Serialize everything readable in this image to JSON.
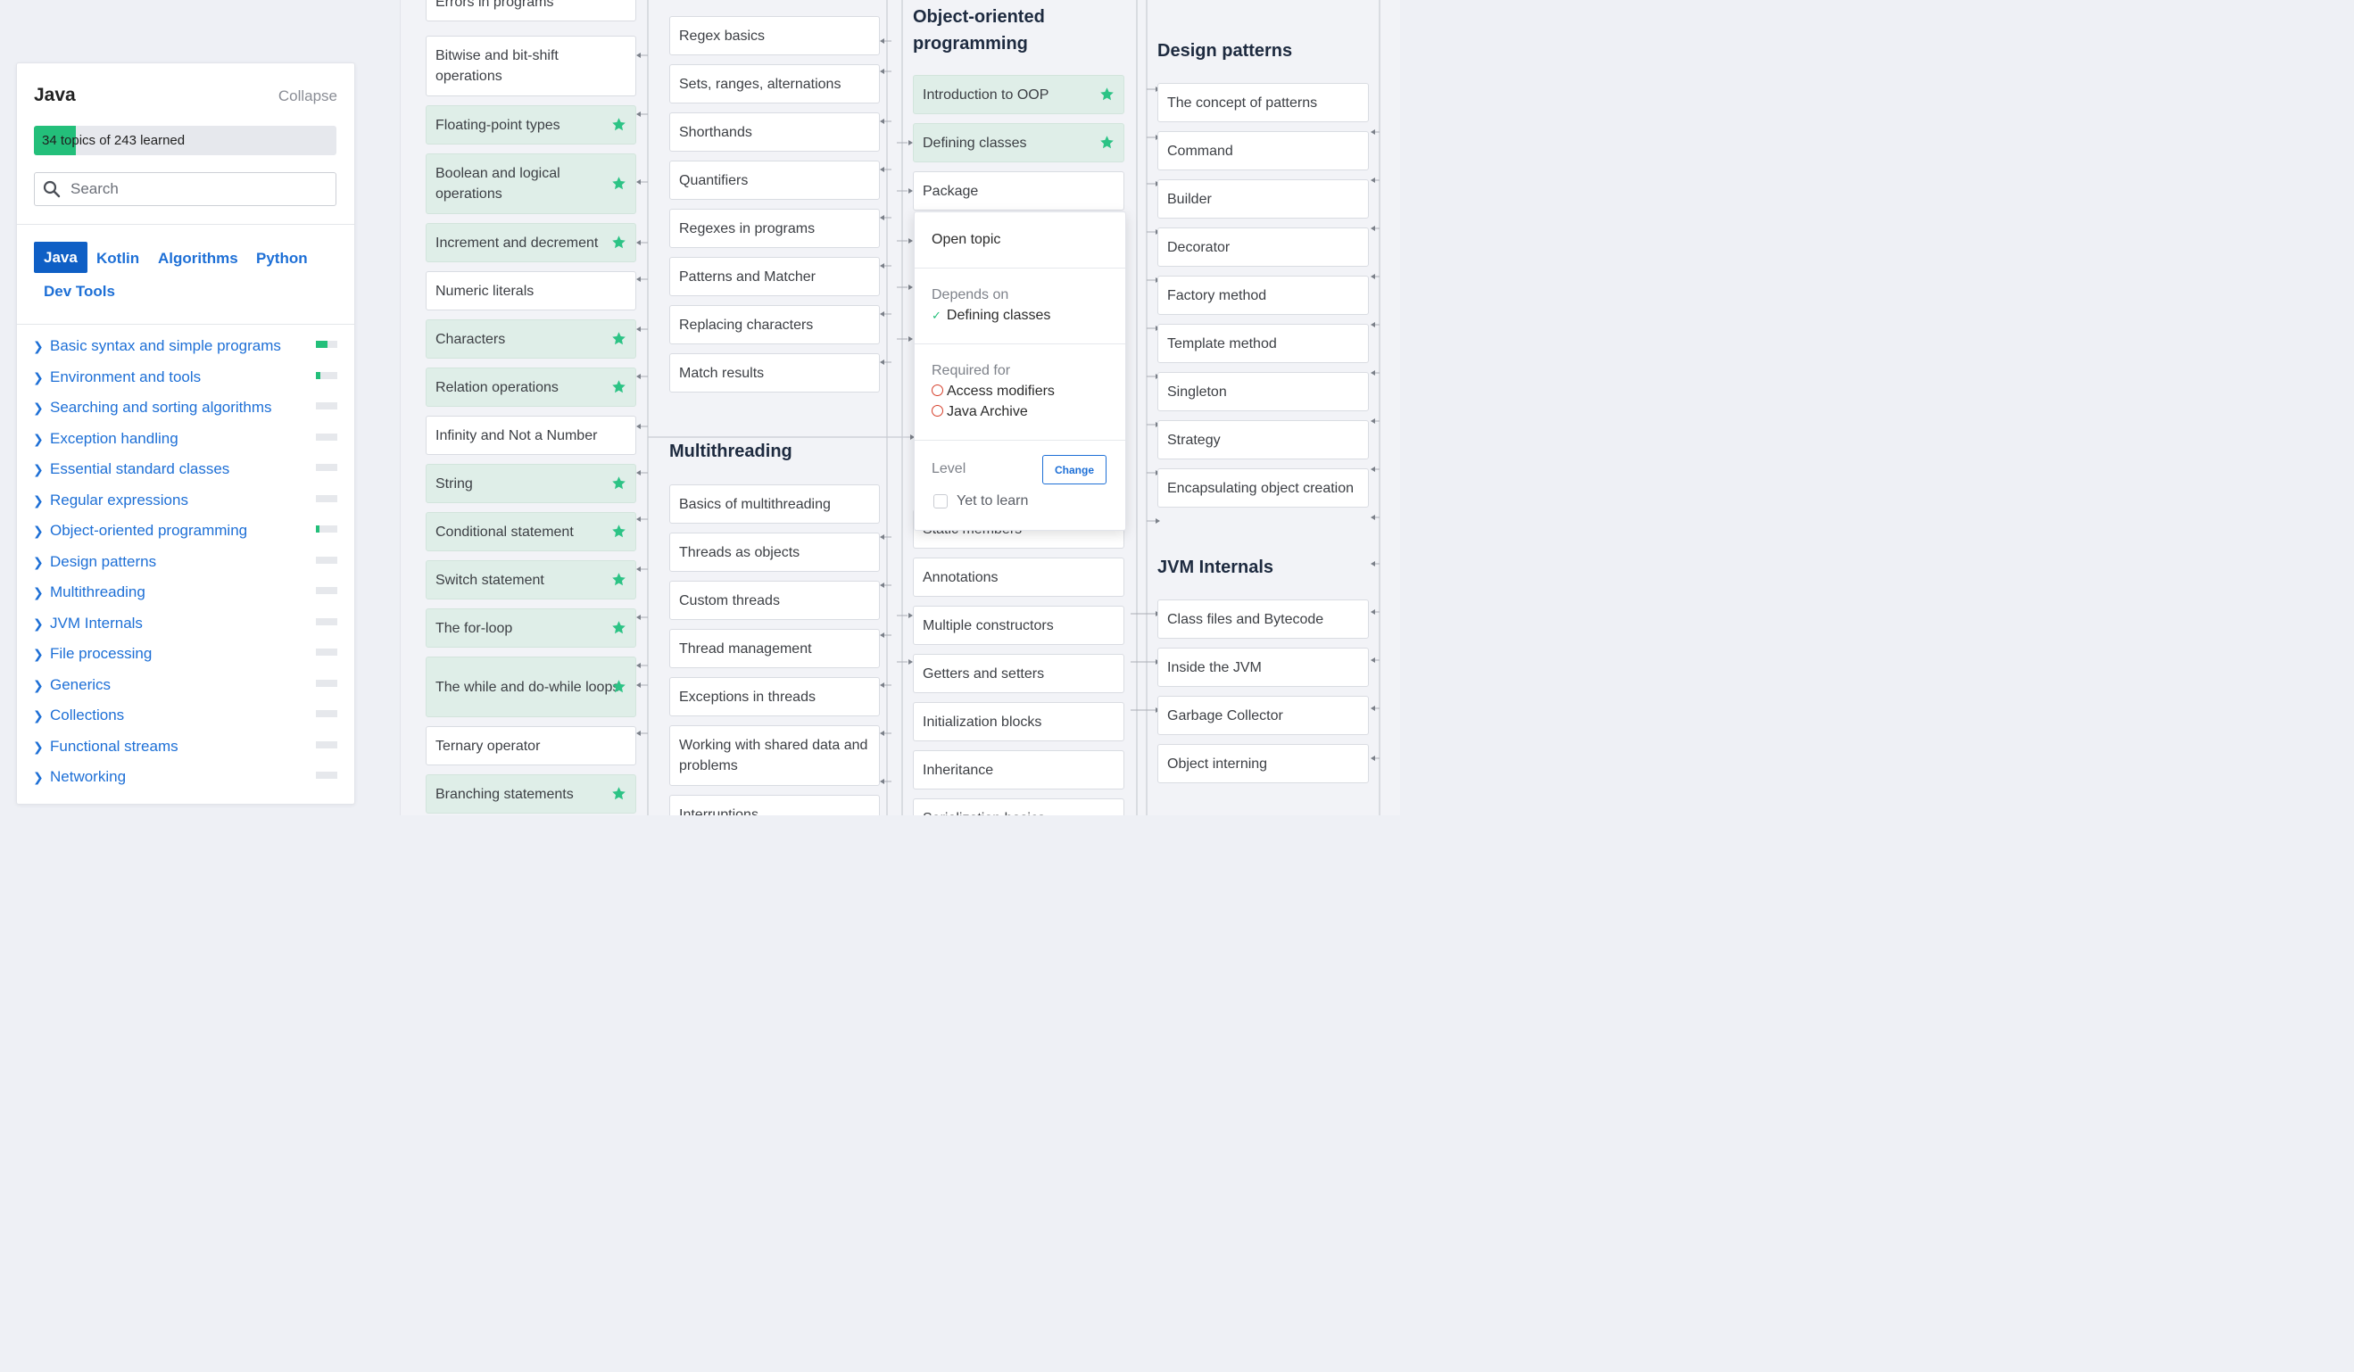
{
  "panel": {
    "title": "Java",
    "collapse": "Collapse",
    "progress_text": "34 topics of 243 learned",
    "progress_fraction": 0.14,
    "search_placeholder": "Search",
    "tabs": [
      "Java",
      "Kotlin",
      "Algorithms",
      "Python",
      "Dev Tools"
    ],
    "active_tab": "Java",
    "topics": [
      {
        "label": "Basic syntax and simple programs",
        "progress": 0.55
      },
      {
        "label": "Environment and tools",
        "progress": 0.2
      },
      {
        "label": "Searching and sorting algorithms",
        "progress": 0
      },
      {
        "label": "Exception handling",
        "progress": 0
      },
      {
        "label": "Essential standard classes",
        "progress": 0
      },
      {
        "label": "Regular expressions",
        "progress": 0
      },
      {
        "label": "Object-oriented programming",
        "progress": 0.15
      },
      {
        "label": "Design patterns",
        "progress": 0
      },
      {
        "label": "Multithreading",
        "progress": 0
      },
      {
        "label": "JVM Internals",
        "progress": 0
      },
      {
        "label": "File processing",
        "progress": 0
      },
      {
        "label": "Generics",
        "progress": 0
      },
      {
        "label": "Collections",
        "progress": 0
      },
      {
        "label": "Functional streams",
        "progress": 0
      },
      {
        "label": "Networking",
        "progress": 0
      }
    ]
  },
  "map": {
    "col1": [
      {
        "label": "Errors in programs",
        "learned": false
      },
      {
        "label": "Bitwise and bit-shift operations",
        "learned": false
      },
      {
        "label": "Floating-point types",
        "learned": true
      },
      {
        "label": "Boolean and logical operations",
        "learned": true
      },
      {
        "label": "Increment and decrement",
        "learned": true
      },
      {
        "label": "Numeric literals",
        "learned": false
      },
      {
        "label": "Characters",
        "learned": true
      },
      {
        "label": "Relation operations",
        "learned": true
      },
      {
        "label": "Infinity and Not a Number",
        "learned": false
      },
      {
        "label": "String",
        "learned": true
      },
      {
        "label": "Conditional statement",
        "learned": true
      },
      {
        "label": "Switch statement",
        "learned": true
      },
      {
        "label": "The for-loop",
        "learned": true
      },
      {
        "label": "The while and do-while loops",
        "learned": true
      },
      {
        "label": "Ternary operator",
        "learned": false
      },
      {
        "label": "Branching statements",
        "learned": true
      }
    ],
    "col2_regex": [
      "Regex basics",
      "Sets, ranges, alternations",
      "Shorthands",
      "Quantifiers",
      "Regexes in programs",
      "Patterns and Matcher",
      "Replacing characters",
      "Match results"
    ],
    "multithreading_heading": "Multithreading",
    "col2_threads": [
      "Basics of multithreading",
      "Threads as objects",
      "Custom threads",
      "Thread management",
      "Exceptions in threads",
      "Working with shared data and problems",
      "Interruptions"
    ],
    "oop_heading": "Object-oriented programming",
    "col3_top": [
      {
        "label": "Introduction to OOP",
        "learned": true
      },
      {
        "label": "Defining classes",
        "learned": true
      },
      {
        "label": "Package",
        "learned": false
      }
    ],
    "col3_hidden": "Static members",
    "col3_bottom": [
      "Annotations",
      "Multiple constructors",
      "Getters and setters",
      "Initialization blocks",
      "Inheritance",
      "Serialization basics"
    ],
    "design_heading": "Design patterns",
    "col4_design": [
      "The concept of patterns",
      "Command",
      "Builder",
      "Decorator",
      "Factory method",
      "Template method",
      "Singleton",
      "Strategy",
      "Encapsulating object creation"
    ],
    "jvm_heading": "JVM Internals",
    "col4_jvm": [
      "Class files and Bytecode",
      "Inside the JVM",
      "Garbage Collector",
      "Object interning"
    ]
  },
  "popup": {
    "open_topic": "Open topic",
    "depends_on_label": "Depends on",
    "depends_on": [
      "Defining classes"
    ],
    "required_for_label": "Required for",
    "required_for": [
      "Access modifiers",
      "Java Archive"
    ],
    "level_label": "Level",
    "change_button": "Change",
    "level_value": "Yet to learn"
  },
  "colors": {
    "accent": "#1d6fd6",
    "learned_bg": "#dfeee8",
    "star": "#2cc385",
    "progress": "#23bf7a",
    "required": "#d6402c"
  }
}
